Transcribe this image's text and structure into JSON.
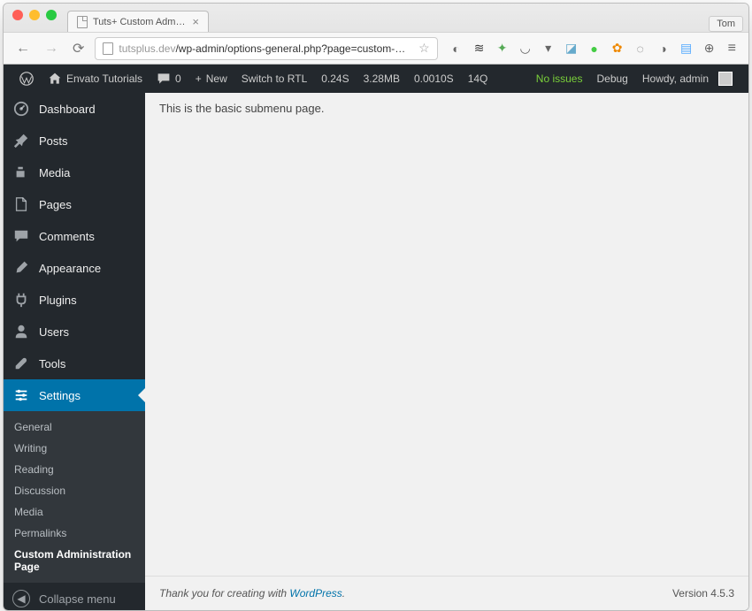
{
  "browser": {
    "tab_title": "Tuts+ Custom Administrati",
    "user_label": "Tom",
    "url_host": "tutsplus.dev",
    "url_path": "/wp-admin/options-general.php?page=custom-…"
  },
  "adminbar": {
    "site_name": "Envato Tutorials",
    "comments_count": "0",
    "new_label": "New",
    "switch_rtl": "Switch to RTL",
    "timing": "0.24S",
    "memory": "3.28MB",
    "db_time": "0.0010S",
    "queries": "14Q",
    "no_issues": "No issues",
    "debug": "Debug",
    "howdy": "Howdy, admin"
  },
  "sidebar": {
    "dashboard": "Dashboard",
    "posts": "Posts",
    "media": "Media",
    "pages": "Pages",
    "comments": "Comments",
    "appearance": "Appearance",
    "plugins": "Plugins",
    "users": "Users",
    "tools": "Tools",
    "settings": "Settings",
    "collapse": "Collapse menu",
    "submenu": {
      "general": "General",
      "writing": "Writing",
      "reading": "Reading",
      "discussion": "Discussion",
      "media": "Media",
      "permalinks": "Permalinks",
      "custom": "Custom Administration Page"
    }
  },
  "content": {
    "body_text": "This is the basic submenu page."
  },
  "footer": {
    "thanks_prefix": "Thank you for creating with ",
    "thanks_link": "WordPress",
    "thanks_suffix": ".",
    "version": "Version 4.5.3"
  }
}
